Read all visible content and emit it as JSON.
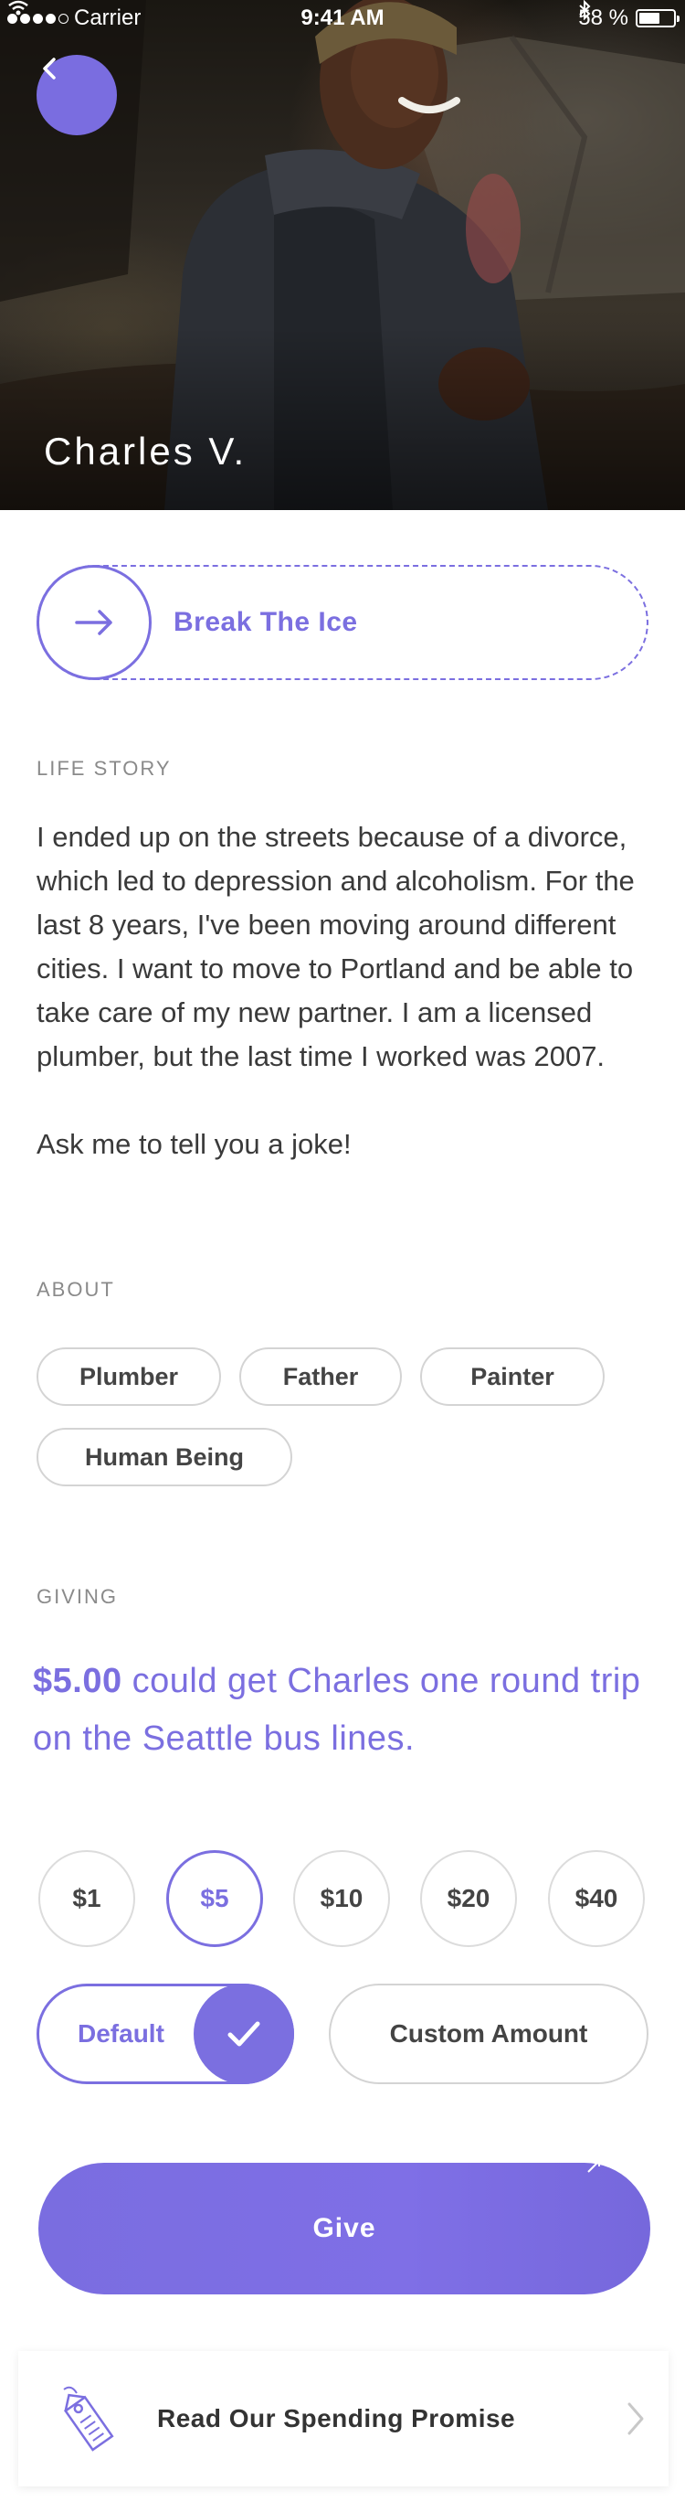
{
  "status_bar": {
    "carrier": "Carrier",
    "time": "9:41 AM",
    "battery": "58 %"
  },
  "profile": {
    "name": "Charles V."
  },
  "break_the_ice": {
    "label": "Break The Ice"
  },
  "life_story": {
    "title": "LIFE STORY",
    "paragraph_1": "I ended up on the streets because of a divorce, which led to depression and alcoholism. For the last 8 years, I've been moving around different cities. I want to move to Portland and be able to take care of my new partner. I am a licensed plumber, but the last time I worked was 2007.",
    "paragraph_2": "Ask me to tell you a joke!"
  },
  "about": {
    "title": "ABOUT",
    "tags": [
      "Plumber",
      "Father",
      "Painter",
      "Human Being"
    ]
  },
  "giving": {
    "title": "GIVING",
    "highlight": "$5.00",
    "description": " could get Charles one round trip on the Seattle bus lines.",
    "amounts": [
      "$1",
      "$5",
      "$10",
      "$20",
      "$40"
    ],
    "selected_amount": "$5",
    "default_label": "Default",
    "custom_label": "Custom Amount",
    "give_label": "Give"
  },
  "promise": {
    "label": "Read Our Spending Promise"
  },
  "colors": {
    "accent": "#7b6fe0",
    "border": "#d4d4d4"
  }
}
